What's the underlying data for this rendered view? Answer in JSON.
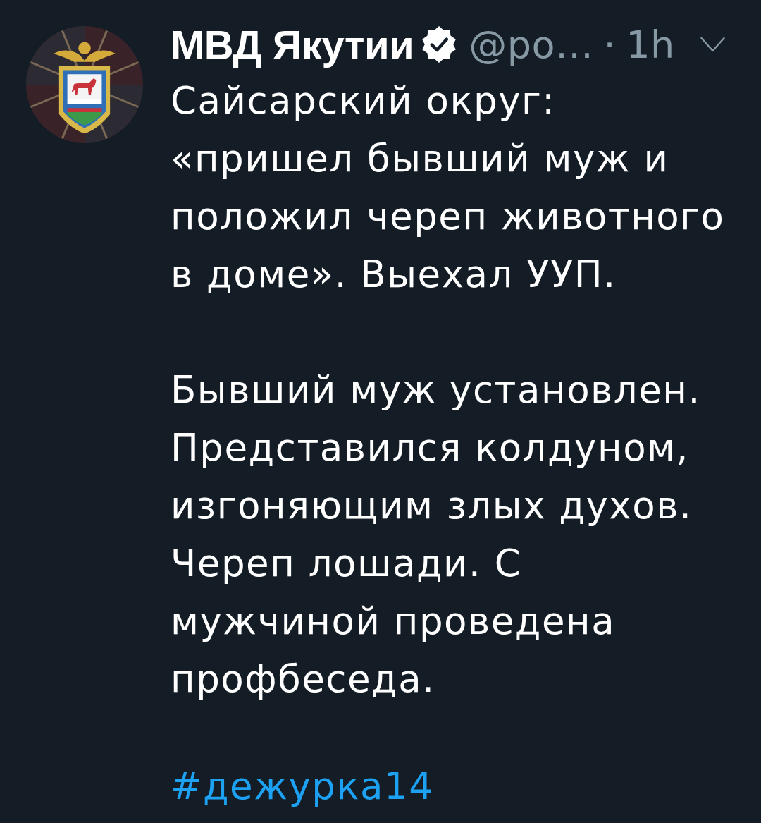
{
  "author": {
    "name": "МВД Якутии",
    "verified": true,
    "handle": "@po…",
    "separator": "·",
    "time": "1h"
  },
  "paragraphs": [
    "Сайсарский округ:\n«пришел бывший муж и\nположил череп животного\nв доме». Выехал УУП.",
    "Бывший муж установлен.\nПредставился колдуном,\nизгоняющим злых духов.\nЧереп лошади. С\nмужчиной проведена\nпрофбеседа."
  ],
  "hashtag": "#дежурка14"
}
